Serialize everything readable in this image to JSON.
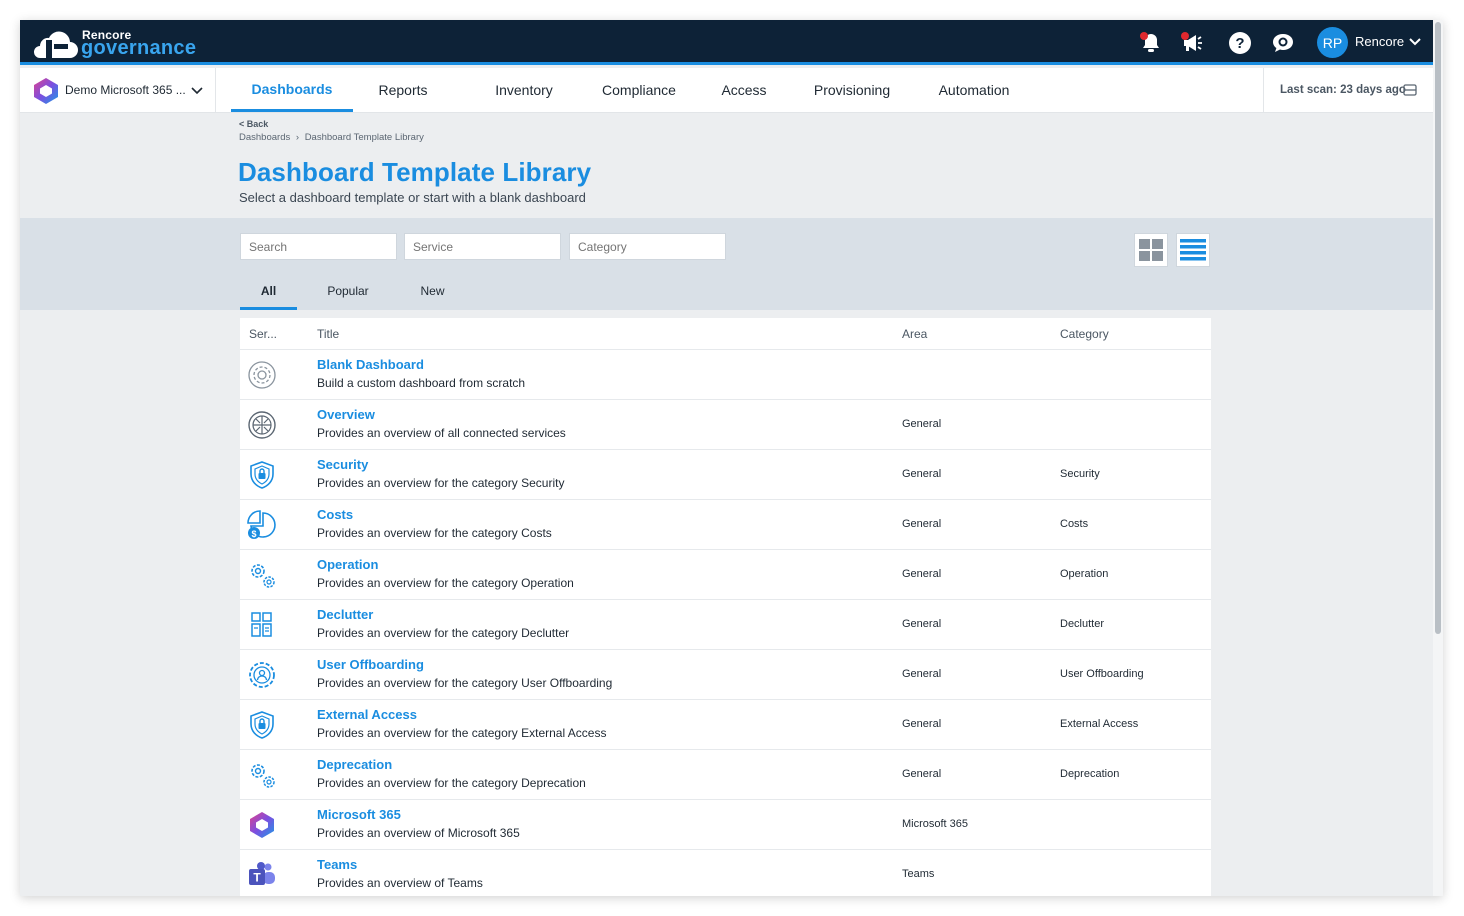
{
  "brand": {
    "small": "Rencore",
    "big": "governance"
  },
  "user": {
    "initials": "RP",
    "name": "Rencore"
  },
  "tenant": {
    "name": "Demo Microsoft 365 ..."
  },
  "nav": {
    "tabs": [
      {
        "label": "Dashboards",
        "active": true
      },
      {
        "label": "Reports"
      },
      {
        "label": "Inventory"
      },
      {
        "label": "Compliance"
      },
      {
        "label": "Access"
      },
      {
        "label": "Provisioning"
      },
      {
        "label": "Automation"
      }
    ],
    "last_scan": "Last scan: 23 days ago"
  },
  "header": {
    "back": "< Back",
    "breadcrumb": [
      "Dashboards",
      "Dashboard Template Library"
    ],
    "title": "Dashboard Template Library",
    "subtitle": "Select a dashboard template or start with a blank dashboard"
  },
  "filters": {
    "search_placeholder": "Search",
    "service_placeholder": "Service",
    "category_placeholder": "Category",
    "tabs": [
      "All",
      "Popular",
      "New"
    ]
  },
  "table": {
    "columns": [
      "Ser...",
      "Title",
      "Area",
      "Category"
    ],
    "rows": [
      {
        "icon": "gear-outline-icon",
        "title": "Blank Dashboard",
        "desc": "Build a custom dashboard from scratch",
        "area": "",
        "category": ""
      },
      {
        "icon": "circuit-globe-icon",
        "title": "Overview",
        "desc": "Provides an overview of all connected services",
        "area": "General",
        "category": ""
      },
      {
        "icon": "shield-lock-icon",
        "title": "Security",
        "desc": "Provides an overview for the category Security",
        "area": "General",
        "category": "Security"
      },
      {
        "icon": "pie-dollar-icon",
        "title": "Costs",
        "desc": "Provides an overview for the category Costs",
        "area": "General",
        "category": "Costs"
      },
      {
        "icon": "gears-icon",
        "title": "Operation",
        "desc": "Provides an overview for the category Operation",
        "area": "General",
        "category": "Operation"
      },
      {
        "icon": "declutter-grid-icon",
        "title": "Declutter",
        "desc": "Provides an overview for the category Declutter",
        "area": "General",
        "category": "Declutter"
      },
      {
        "icon": "user-gear-icon",
        "title": "User Offboarding",
        "desc": "Provides an overview for the category User Offboarding",
        "area": "General",
        "category": "User Offboarding"
      },
      {
        "icon": "shield-lock-icon",
        "title": "External Access",
        "desc": "Provides an overview for the category External Access",
        "area": "General",
        "category": "External Access"
      },
      {
        "icon": "gears-icon",
        "title": "Deprecation",
        "desc": "Provides an overview for the category Deprecation",
        "area": "General",
        "category": "Deprecation"
      },
      {
        "icon": "microsoft-365-icon",
        "title": "Microsoft 365",
        "desc": "Provides an overview of Microsoft 365",
        "area": "Microsoft 365",
        "category": ""
      },
      {
        "icon": "teams-icon",
        "title": "Teams",
        "desc": "Provides an overview of Teams",
        "area": "Teams",
        "category": ""
      }
    ]
  },
  "colors": {
    "accent": "#1a8de0",
    "topbar": "#0d2237",
    "panel": "#d9e0e7",
    "page_bg": "#eceef0"
  }
}
